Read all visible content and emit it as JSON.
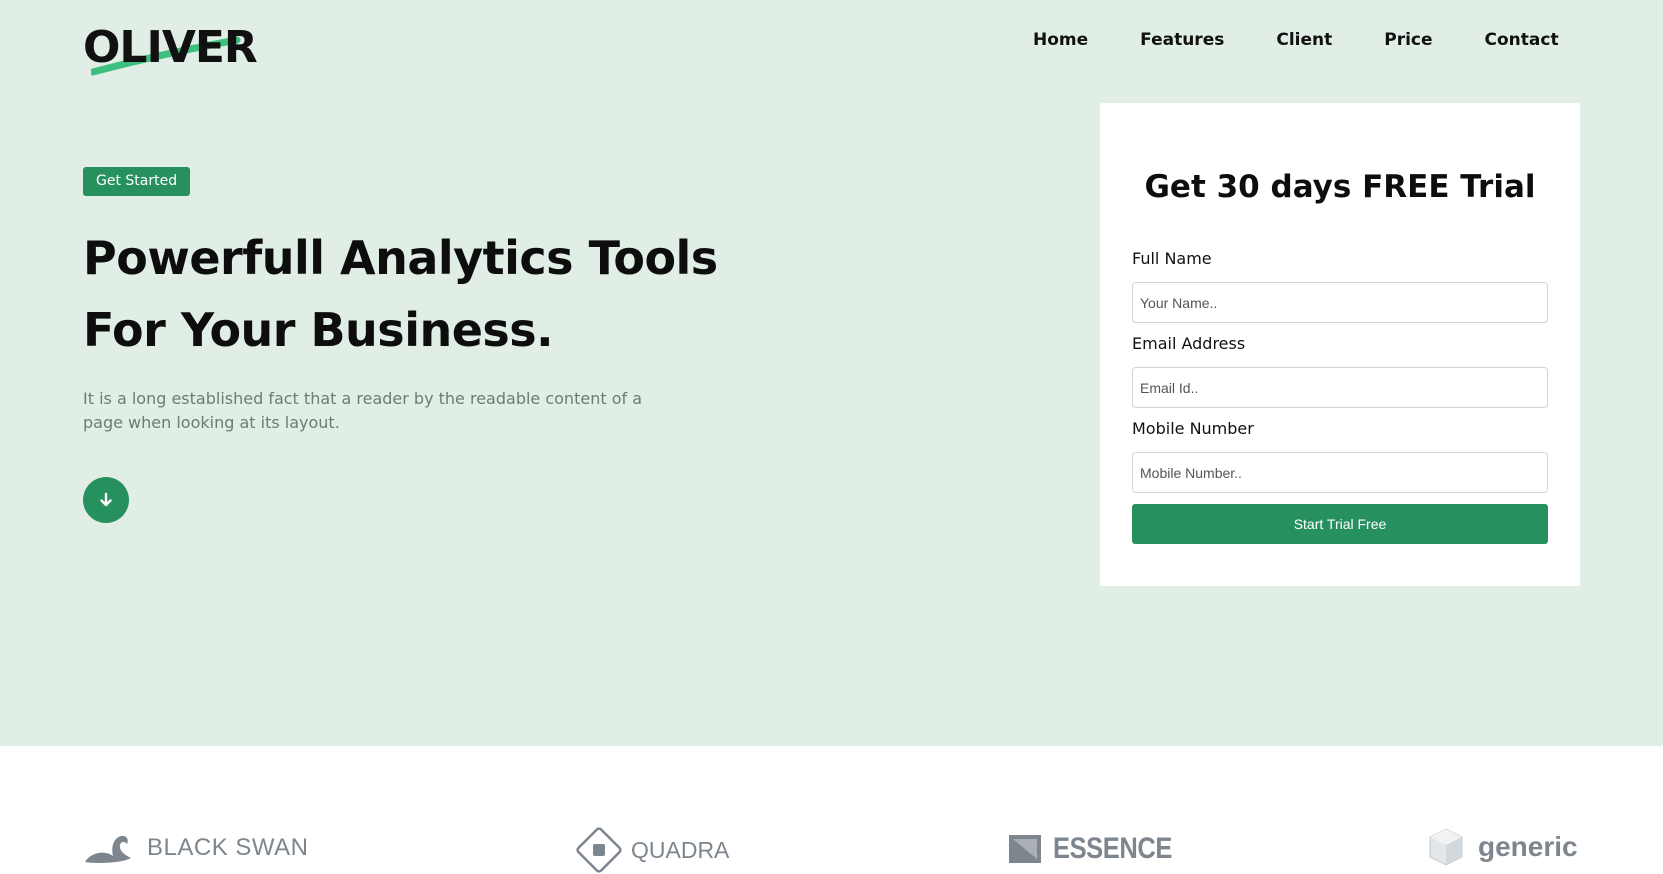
{
  "logo": {
    "text": "OLIVER",
    "accent_color": "#3fbf7f"
  },
  "nav": {
    "items": [
      "Home",
      "Features",
      "Client",
      "Price",
      "Contact"
    ]
  },
  "hero": {
    "badge": "Get Started",
    "headline_line1": "Powerfull Analytics Tools",
    "headline_line2": "For Your Business.",
    "description": "It is a long established fact that a reader by the readable content of a page when looking at its layout.",
    "scroll_icon": "arrow-down-icon",
    "background_color": "#e0eee6",
    "accent_color": "#27905f"
  },
  "trial_form": {
    "title": "Get 30 days FREE Trial",
    "fields": [
      {
        "label": "Full Name",
        "placeholder": "Your Name.."
      },
      {
        "label": "Email Address",
        "placeholder": "Email Id.."
      },
      {
        "label": "Mobile Number",
        "placeholder": "Mobile Number.."
      }
    ],
    "submit_label": "Start Trial Free"
  },
  "brands": [
    {
      "name": "BLACK SWAN",
      "icon": "swan-icon"
    },
    {
      "name": "QUADRA",
      "icon": "diamond-square-icon"
    },
    {
      "name": "ESSENCE",
      "icon": "flag-icon"
    },
    {
      "name": "generic",
      "icon": "cube-icon"
    }
  ]
}
